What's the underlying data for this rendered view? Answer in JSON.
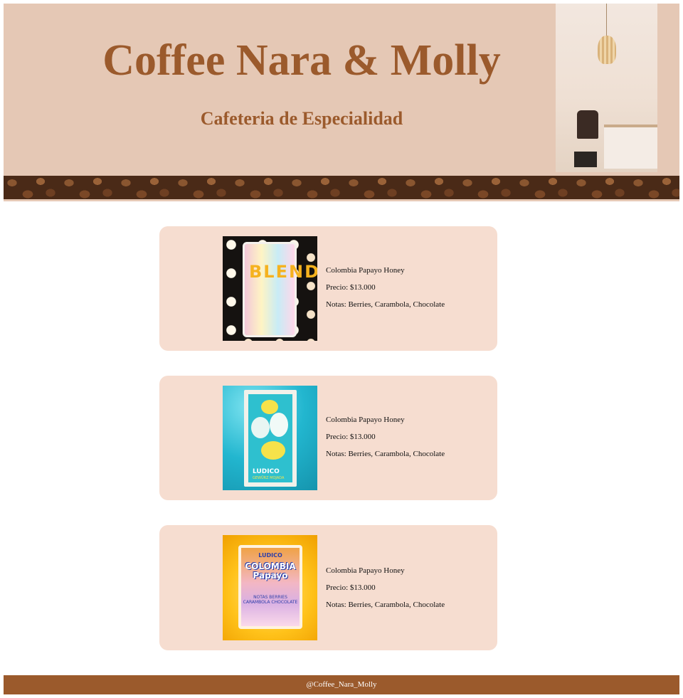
{
  "header": {
    "title": "Coffee Nara & Molly",
    "subtitle": "Cafeteria de Especialidad"
  },
  "products": [
    {
      "name": "Colombia Papayo Honey",
      "price": "Precio: $13.000",
      "notes": "Notas: Berries, Carambola, Chocolate",
      "image_text": "BLEND"
    },
    {
      "name": "Colombia Papayo Honey",
      "price": "Precio: $13.000",
      "notes": "Notas: Berries, Carambola, Chocolate",
      "image_text": "LUDICO",
      "image_subtext": "GEWÜRZ MOJADA"
    },
    {
      "name": "Colombia Papayo Honey",
      "price": "Precio: $13.000",
      "notes": "Notas: Berries, Carambola, Chocolate",
      "image_brand": "LUDICO",
      "image_title": "COLOMBIA Papayo",
      "image_notes": "NOTAS BERRIES CARAMBOLA CHOCOLATE"
    }
  ],
  "footer": {
    "handle": "@Coffee_Nara_Molly"
  },
  "colors": {
    "brand_brown": "#9b5a2c",
    "header_bg": "#e5c8b5",
    "card_bg": "#f6ddd0"
  }
}
